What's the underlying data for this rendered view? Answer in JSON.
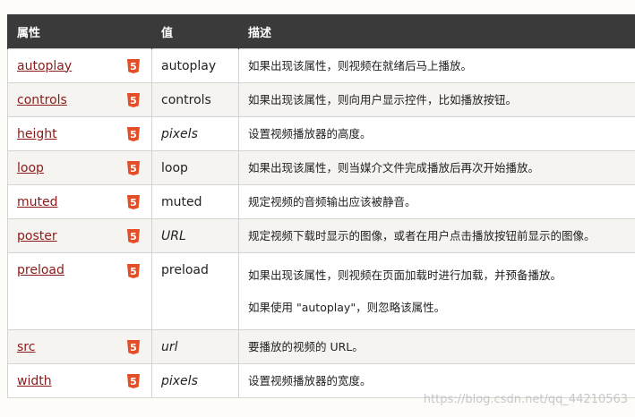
{
  "table": {
    "headers": [
      "属性",
      "值",
      "描述"
    ],
    "rows": [
      {
        "name": "autoplay",
        "value": "autoplay",
        "value_italic": false,
        "desc": [
          "如果出现该属性，则视频在就绪后马上播放。"
        ]
      },
      {
        "name": "controls",
        "value": "controls",
        "value_italic": false,
        "desc": [
          "如果出现该属性，则向用户显示控件，比如播放按钮。"
        ]
      },
      {
        "name": "height",
        "value": "pixels",
        "value_italic": true,
        "desc": [
          "设置视频播放器的高度。"
        ]
      },
      {
        "name": "loop",
        "value": "loop",
        "value_italic": false,
        "desc": [
          "如果出现该属性，则当媒介文件完成播放后再次开始播放。"
        ]
      },
      {
        "name": "muted",
        "value": "muted",
        "value_italic": false,
        "desc": [
          "规定视频的音频输出应该被静音。"
        ]
      },
      {
        "name": "poster",
        "value": "URL",
        "value_italic": true,
        "desc": [
          "规定视频下载时显示的图像，或者在用户点击播放按钮前显示的图像。"
        ]
      },
      {
        "name": "preload",
        "value": "preload",
        "value_italic": false,
        "desc": [
          "如果出现该属性，则视频在页面加载时进行加载，并预备播放。",
          "如果使用 \"autoplay\"，则忽略该属性。"
        ]
      },
      {
        "name": "src",
        "value": "url",
        "value_italic": true,
        "desc": [
          "要播放的视频的 URL。"
        ]
      },
      {
        "name": "width",
        "value": "pixels",
        "value_italic": true,
        "desc": [
          "设置视频播放器的宽度。"
        ]
      }
    ]
  },
  "badge": {
    "icon": "html5-icon",
    "color": "#e44d26",
    "glyph": "5"
  },
  "colors": {
    "header_bg": "#3a3a3a",
    "link": "#8b1a1a",
    "alt_row": "#f6f4f0"
  },
  "watermark": "https://blog.csdn.net/qq_44210563"
}
